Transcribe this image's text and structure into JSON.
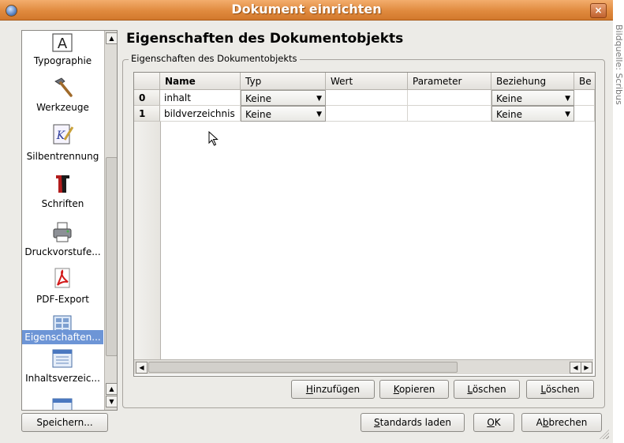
{
  "window": {
    "title": "Dokument einrichten",
    "close_glyph": "×"
  },
  "watermark": "Bildquelle: Scribus",
  "sidebar": {
    "items": [
      {
        "label": "Typographie",
        "icon": "typography-icon"
      },
      {
        "label": "Werkzeuge",
        "icon": "hammer-icon"
      },
      {
        "label": "Silbentrennung",
        "icon": "hyphenation-icon"
      },
      {
        "label": "Schriften",
        "icon": "fonts-icon"
      },
      {
        "label": "Druckvorstufe...",
        "icon": "printer-icon"
      },
      {
        "label": "PDF-Export",
        "icon": "pdf-icon"
      },
      {
        "label": "Eigenschaften...",
        "icon": "properties-icon",
        "selected": true
      },
      {
        "label": "Inhaltsverzeic...",
        "icon": "toc-icon"
      }
    ]
  },
  "main": {
    "heading": "Eigenschaften des Dokumentobjekts",
    "group_label": "Eigenschaften des Dokumentobjekts",
    "table": {
      "columns": [
        "Name",
        "Typ",
        "Wert",
        "Parameter",
        "Beziehung",
        "Be"
      ],
      "rows": [
        {
          "index": "0",
          "name": "inhalt",
          "typ": "Keine",
          "wert": "",
          "parameter": "",
          "beziehung": "Keine"
        },
        {
          "index": "1",
          "name": "bildverzeichnis",
          "typ": "Keine",
          "wert": "",
          "parameter": "",
          "beziehung": "Keine"
        }
      ]
    },
    "buttons": {
      "add_pre": "",
      "add_u": "H",
      "add_post": "inzufügen",
      "copy_pre": "",
      "copy_u": "K",
      "copy_post": "opieren",
      "del1_pre": "",
      "del1_u": "L",
      "del1_post": "öschen",
      "del2_pre": "",
      "del2_u": "L",
      "del2_post": "öschen"
    }
  },
  "footer": {
    "save": "Speichern...",
    "defaults_pre": "",
    "defaults_u": "S",
    "defaults_post": "tandards laden",
    "ok_pre": "",
    "ok_u": "O",
    "ok_post": "K",
    "cancel_pre": "A",
    "cancel_u": "b",
    "cancel_post": "brechen"
  }
}
